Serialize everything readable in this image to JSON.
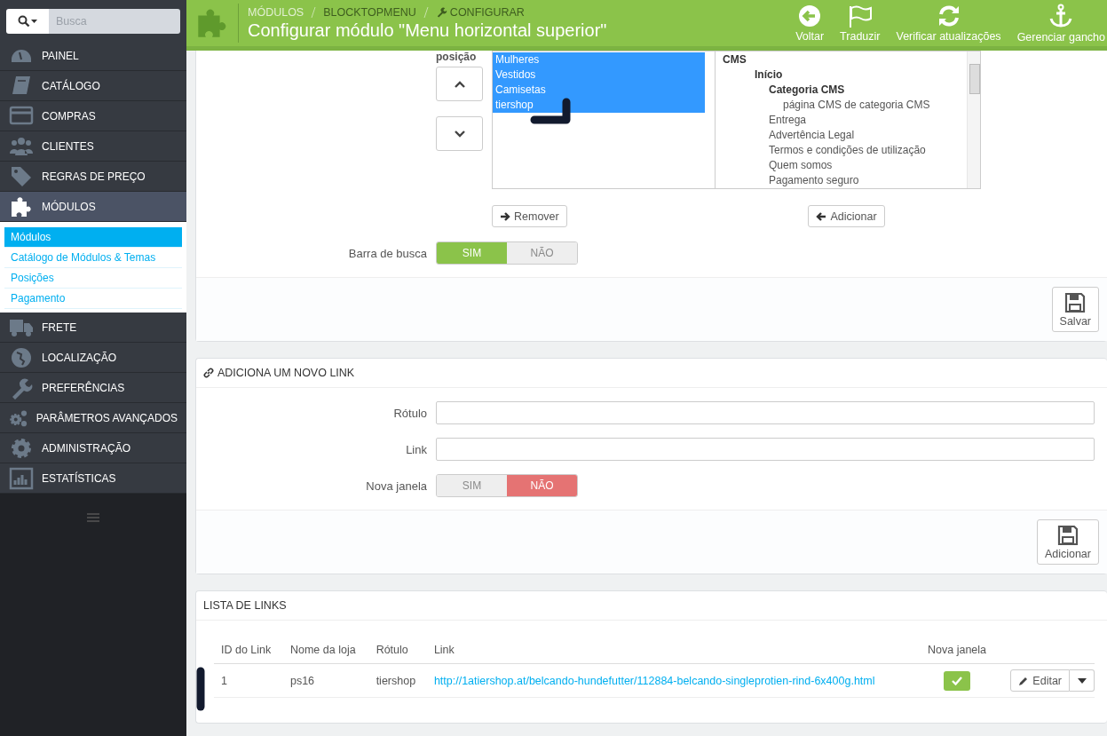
{
  "search": {
    "placeholder": "Busca"
  },
  "header": {
    "breadcrumb": [
      "MÓDULOS",
      "BLOCKTOPMENU",
      "CONFIGURAR"
    ],
    "title": "Configurar módulo \"Menu horizontal superior\"",
    "toolbar": [
      {
        "label": "Voltar",
        "kind": "back"
      },
      {
        "label": "Traduzir",
        "kind": "flag"
      },
      {
        "label": "Verificar atualizações",
        "kind": "refresh"
      },
      {
        "label": "Gerenciar gancho",
        "kind": "anchor"
      }
    ]
  },
  "sidebar": {
    "items": [
      {
        "label": "PAINEL",
        "kind": "gauge",
        "selected": false
      },
      {
        "label": "CATÁLOGO",
        "kind": "book",
        "selected": false
      },
      {
        "label": "COMPRAS",
        "kind": "card",
        "selected": false
      },
      {
        "label": "CLIENTES",
        "kind": "people",
        "selected": false
      },
      {
        "label": "REGRAS DE PREÇO",
        "kind": "tag",
        "selected": false
      },
      {
        "label": "MÓDULOS",
        "kind": "puzzle",
        "selected": true,
        "children": [
          {
            "label": "Módulos",
            "selected": true
          },
          {
            "label": "Catálogo de Módulos & Temas",
            "selected": false
          },
          {
            "label": "Posições",
            "selected": false
          },
          {
            "label": "Pagamento",
            "selected": false
          }
        ]
      },
      {
        "label": "FRETE",
        "kind": "truck",
        "selected": false
      },
      {
        "label": "LOCALIZAÇÃO",
        "kind": "globe",
        "selected": false
      },
      {
        "label": "PREFERÊNCIAS",
        "kind": "wrench",
        "selected": false
      },
      {
        "label": "PARÂMETROS AVANÇADOS",
        "kind": "gears",
        "selected": false
      },
      {
        "label": "ADMINISTRAÇÃO",
        "kind": "gear",
        "selected": false
      },
      {
        "label": "ESTATÍSTICAS",
        "kind": "chart",
        "selected": false
      }
    ]
  },
  "menu_panel": {
    "position_label": "posição",
    "selected_items": [
      {
        "label": "Mulheres",
        "selected": true
      },
      {
        "label": "Vestidos",
        "selected": true
      },
      {
        "label": "Camisetas",
        "selected": true
      },
      {
        "label": "tiershop",
        "selected": true
      }
    ],
    "available_items": [
      {
        "label": "CMS",
        "kind": "category",
        "children": [
          {
            "label": "Início",
            "kind": "category",
            "children": [
              {
                "label": "Categoria CMS",
                "kind": "category",
                "children": [
                  {
                    "label": "página CMS de categoria CMS",
                    "kind": "page"
                  }
                ]
              },
              {
                "label": "Entrega",
                "kind": "page"
              },
              {
                "label": "Advertência Legal",
                "kind": "page"
              },
              {
                "label": "Termos e condições de utilização",
                "kind": "page"
              },
              {
                "label": "Quem somos",
                "kind": "page"
              },
              {
                "label": "Pagamento seguro",
                "kind": "page"
              }
            ]
          }
        ]
      }
    ],
    "remove_button": "Remover",
    "add_button": "Adicionar",
    "search_bar": {
      "label": "Barra de busca",
      "options": [
        {
          "label": "SIM",
          "selected": true
        },
        {
          "label": "NÃO",
          "selected": false
        }
      ]
    },
    "save_button": "Salvar"
  },
  "new_link_panel": {
    "title": "ADICIONA UM NOVO LINK",
    "fields": [
      {
        "label": "Rótulo"
      },
      {
        "label": "Link"
      }
    ],
    "new_window": {
      "label": "Nova janela",
      "options": [
        {
          "label": "SIM",
          "selected": false
        },
        {
          "label": "NÃO",
          "selected": true
        }
      ]
    },
    "add_button": "Adicionar"
  },
  "links_panel": {
    "title": "LISTA DE LINKS",
    "table": {
      "columns": [
        "ID do Link",
        "Nome da loja",
        "Rótulo",
        "Link",
        "Nova janela"
      ],
      "rows": [
        {
          "id": "1",
          "shop": "ps16",
          "label": "tiershop",
          "link": "http://1atiershop.at/belcando-hundefutter/112884-belcando-singleprotien-rind-6x400g.html",
          "new_window": true,
          "edit": "Editar"
        }
      ]
    }
  }
}
